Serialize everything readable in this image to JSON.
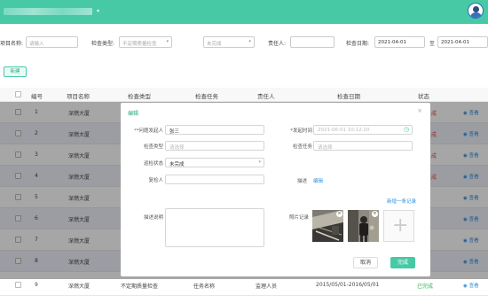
{
  "header": {
    "caret": "▾"
  },
  "filter": {
    "project_label": "项目名称:",
    "project_placeholder": "请输入",
    "type_label": "检查类型:",
    "type_placeholder": "不定期质量检查",
    "status_placeholder": "未完成",
    "owner_label": "责任人:",
    "date_label": "检查日期:",
    "date_from": "2021-04-01",
    "date_sep": "至",
    "date_to": "2021-04-01"
  },
  "toolbar": {
    "new_label": "新建"
  },
  "table": {
    "headers": {
      "no": "编号",
      "project": "项目名称",
      "type": "检查类型",
      "task": "检查任务",
      "owner": "责任人",
      "date": "检查日期",
      "status": "状态"
    },
    "view_label": "查看",
    "rows": [
      {
        "no": "1",
        "project": "深燃大厦",
        "status": "成"
      },
      {
        "no": "2",
        "project": "深燃大厦",
        "status": "成"
      },
      {
        "no": "3",
        "project": "深燃大厦",
        "status": "成"
      },
      {
        "no": "4",
        "project": "深燃大厦",
        "status": "成"
      },
      {
        "no": "5",
        "project": "深燃大厦",
        "status": ""
      },
      {
        "no": "6",
        "project": "深燃大厦",
        "status": ""
      },
      {
        "no": "7",
        "project": "深燃大厦",
        "status": ""
      },
      {
        "no": "8",
        "project": "深燃大厦",
        "status": ""
      },
      {
        "no": "9",
        "project": "深燃大厦",
        "type": "不定期质量检查",
        "task": "任务名称",
        "owner": "监理人员",
        "date": "2015/05/01-2016/05/01",
        "status": "已完成"
      }
    ]
  },
  "modal": {
    "title": "编辑",
    "close": "×",
    "problem_initiator_label": "*问题发起人",
    "problem_initiator_value": "张三",
    "initiated_time_label": "*发起时间",
    "initiated_time_value": "2021-06-01 10:12:20",
    "check_type_label": "检查类型",
    "check_type_placeholder": "请选择",
    "check_task_label": "检查任务",
    "check_task_placeholder": "请选择",
    "rectify_status_label": "巡检状态",
    "rectify_status_value": "未完成",
    "reviewer_label": "复检人",
    "description_label": "描述",
    "edit_link": "编辑",
    "add_record_link": "新增一条记录",
    "desc_label": "描述说明",
    "photo_label": "照片记录",
    "cancel_label": "取消",
    "ok_label": "完成"
  }
}
